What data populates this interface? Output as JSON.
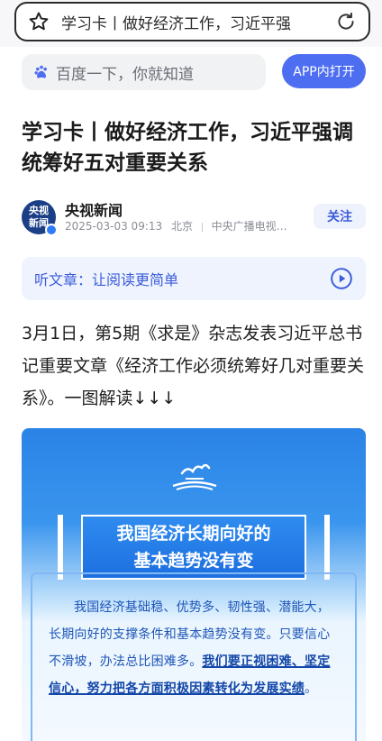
{
  "browser": {
    "url_text": "学习卡丨做好经济工作，习近平强",
    "star_icon": "star-icon",
    "reload_icon": "reload-icon"
  },
  "search": {
    "placeholder": "百度一下，你就知道",
    "app_button": "APP内打开",
    "accent": "#4e6ef2"
  },
  "article": {
    "title": "学习卡丨做好经济工作，习近平强调统筹好五对重要关系",
    "author": {
      "avatar_line1": "央视",
      "avatar_line2": "新闻",
      "name": "央视新闻",
      "datetime": "2025-03-03 09:13",
      "location": "北京",
      "source": "中央广播电视…",
      "follow_label": "关注"
    },
    "listen_label": "听文章：让阅读更简单",
    "paragraph": "3月1日，第5期《求是》杂志发表习近平总书记重要文章《经济工作必须统筹好几对重要关系》。一图解读↓↓↓"
  },
  "infographic": {
    "banner_line1": "我国经济长期向好的",
    "banner_line2": "基本趋势没有变",
    "text_plain": "我国经济基础稳、优势多、韧性强、潜能大，长期向好的支撑条件和基本趋势没有变。只要信心不滑坡，办法总比困难多。",
    "text_bold": "我们要正视困难、坚定信心，努力把各方面积极因素转化为发展实绩",
    "text_end": "。"
  }
}
